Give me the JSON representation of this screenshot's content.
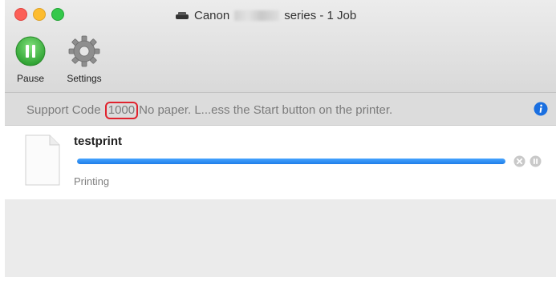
{
  "window": {
    "title_prefix": "Canon",
    "title_suffix": "series - 1 Job"
  },
  "toolbar": {
    "pause_label": "Pause",
    "settings_label": "Settings"
  },
  "status": {
    "prefix": "Support Code",
    "code": "1000",
    "message": "No paper. L...ess the Start button on the printer."
  },
  "job": {
    "name": "testprint",
    "state": "Printing",
    "progress": 1.0
  },
  "colors": {
    "progress": "#2a8cf5",
    "info": "#1a6fe0",
    "pause_button": "#3cb83f",
    "code_highlight": "#e0232e"
  }
}
